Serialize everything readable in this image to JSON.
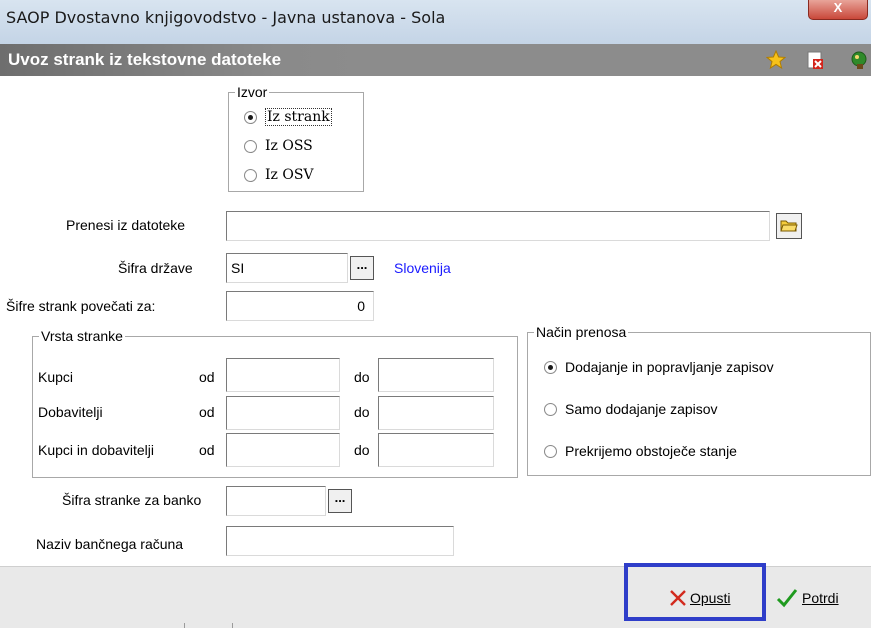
{
  "window": {
    "title": "SAOP Dvostavno knjigovodstvo - Javna ustanova - Sola",
    "close_symbol": "X"
  },
  "header": {
    "title": "Uvoz strank iz tekstovne datoteke",
    "icons": [
      "star-icon",
      "delete-document-icon",
      "exit-icon"
    ]
  },
  "izvor": {
    "legend": "Izvor",
    "options": [
      {
        "label": "Iz strank",
        "checked": true
      },
      {
        "label": "Iz OSS",
        "checked": false
      },
      {
        "label": "Iz OSV",
        "checked": false
      }
    ]
  },
  "fields": {
    "file_label": "Prenesi iz datoteke",
    "file_value": "",
    "country_label": "Šifra države",
    "country_value": "SI",
    "country_browse": "...",
    "country_name": "Slovenija",
    "increase_label": "Šifre strank povečati za:",
    "increase_value": "0"
  },
  "vrsta": {
    "legend": "Vrsta stranke",
    "rows": [
      {
        "label": "Kupci",
        "od": "od",
        "do": "do",
        "od_value": "",
        "do_value": ""
      },
      {
        "label": "Dobavitelji",
        "od": "od",
        "do": "do",
        "od_value": "",
        "do_value": ""
      },
      {
        "label": "Kupci in dobavitelji",
        "od": "od",
        "do": "do",
        "od_value": "",
        "do_value": ""
      }
    ]
  },
  "nacin": {
    "legend": "Način prenosa",
    "options": [
      {
        "label": "Dodajanje in popravljanje zapisov",
        "checked": true
      },
      {
        "label": "Samo dodajanje zapisov",
        "checked": false
      },
      {
        "label": "Prekrijemo obstoječe stanje",
        "checked": false
      }
    ]
  },
  "bank": {
    "code_label": "Šifra stranke za banko",
    "code_value": "",
    "code_browse": "...",
    "account_label": "Naziv bančnega računa",
    "account_value": ""
  },
  "actions": {
    "cancel_label": "Opusti",
    "confirm_label": "Potrdi"
  },
  "colors": {
    "header_bg": "#8c8c8c",
    "link": "#1a1aff",
    "highlight": "#2f3ec9",
    "cancel_icon": "#d22a1e",
    "confirm_icon": "#1f9a1f"
  }
}
